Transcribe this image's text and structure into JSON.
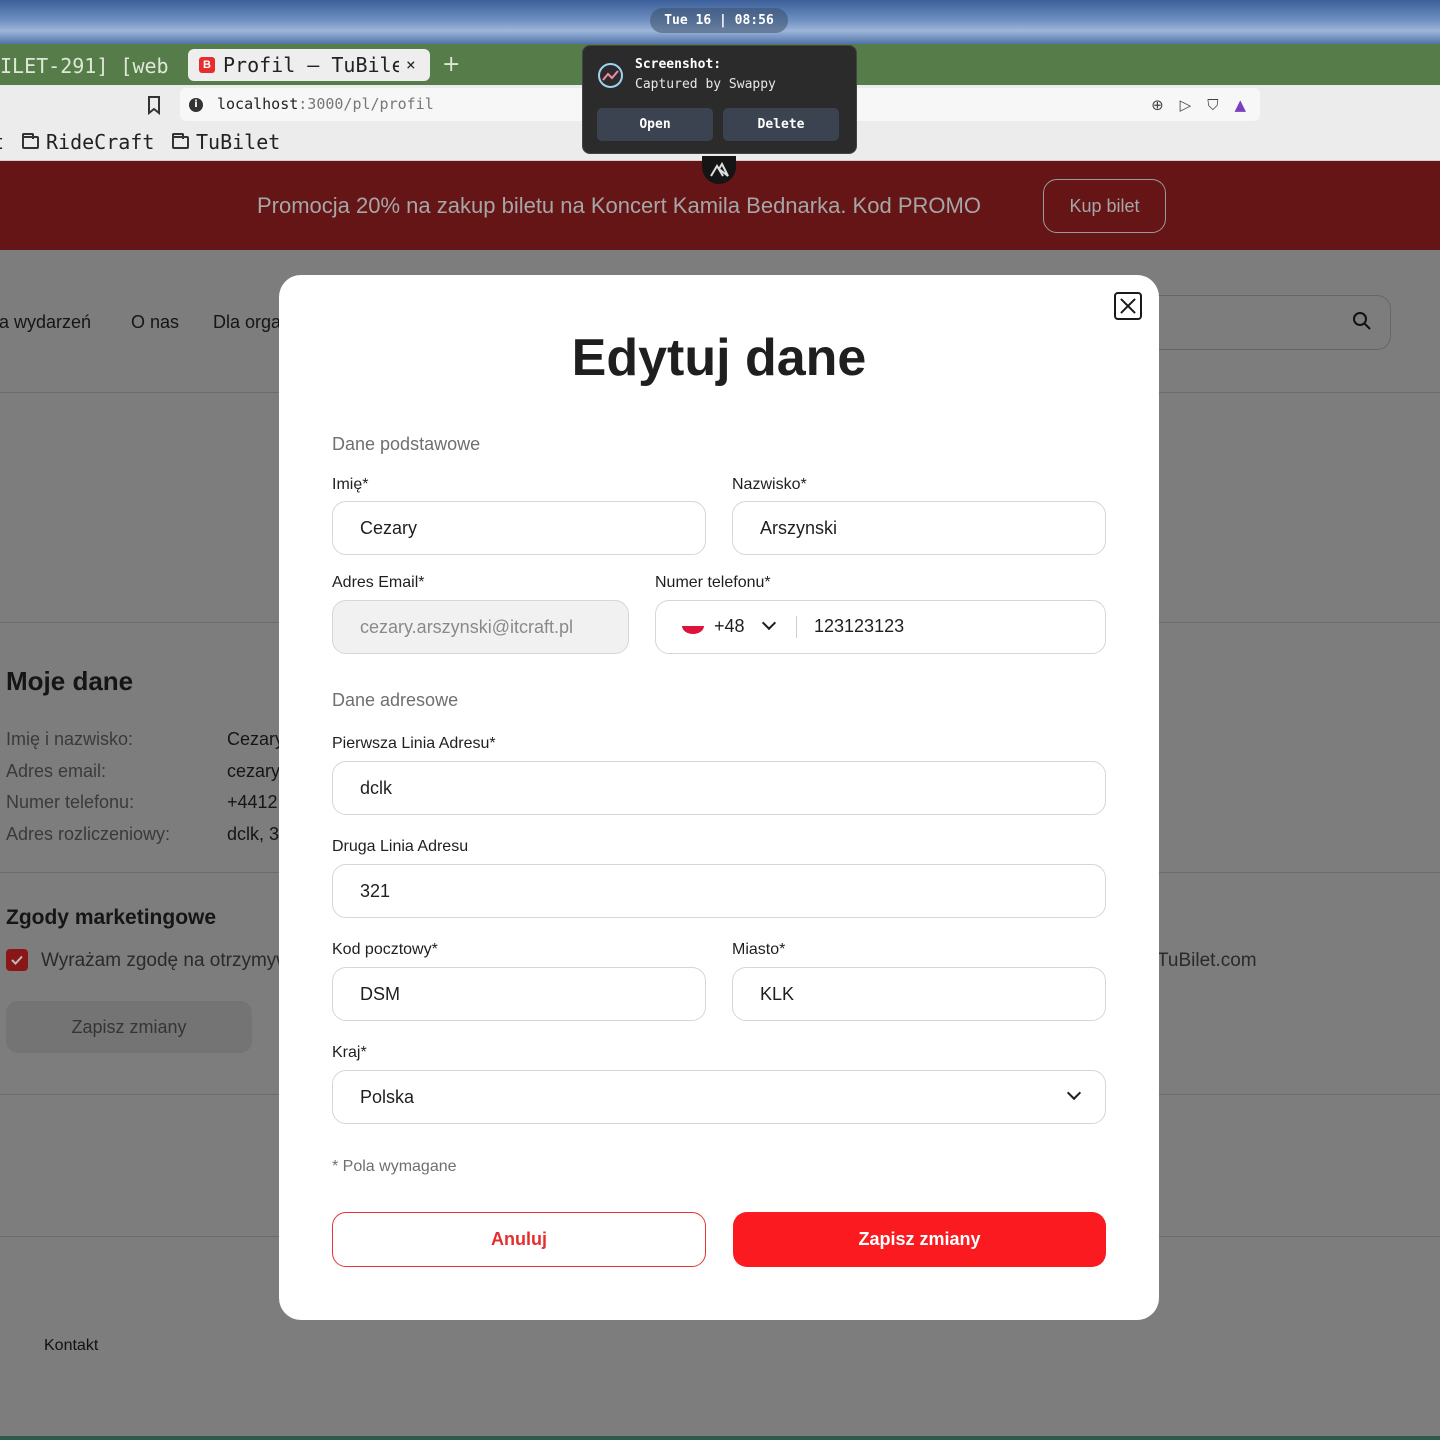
{
  "system": {
    "clock": "Tue 16 | 08:56"
  },
  "browser": {
    "tabs": [
      {
        "label": "ILET-291] [web"
      },
      {
        "label": "Profil – TuBilet",
        "favicon": "B",
        "close": "×"
      }
    ],
    "new_tab": "+",
    "url_host": "localhost",
    "url_rest": ":3000/pl/profil",
    "bookmarks": [
      {
        "label": "RideCraft"
      },
      {
        "label": "TuBilet"
      }
    ]
  },
  "toast": {
    "title": "Screenshot:",
    "subtitle": "Captured by Swappy",
    "open_label": "Open",
    "delete_label": "Delete"
  },
  "page": {
    "promo": {
      "text": "Promocja 20% na zakup biletu na Koncert Kamila Bednarka. Kod PROMO",
      "button": "Kup bilet"
    },
    "nav": [
      "ta wydarzeń",
      "O nas",
      "Dla orga"
    ],
    "my_data": {
      "title": "Moje dane",
      "rows": [
        {
          "label": "Imię i nazwisko:",
          "value": "Cezary"
        },
        {
          "label": "Adres email:",
          "value": "cezary"
        },
        {
          "label": "Numer telefonu:",
          "value": "+4412"
        },
        {
          "label": "Adres rozliczeniowy:",
          "value": "dclk, 3"
        }
      ]
    },
    "marketing": {
      "title": "Zgody marketingowe",
      "consent_text": "Wyrażam zgodę na otrzymyw",
      "consent_tail": "TuBilet.com",
      "save_label": "Zapisz zmiany"
    },
    "footer_link": "Kontakt"
  },
  "modal": {
    "title": "Edytuj dane",
    "section_basic": "Dane podstawowe",
    "section_address": "Dane adresowe",
    "first_name": {
      "label": "Imię*",
      "value": "Cezary"
    },
    "last_name": {
      "label": "Nazwisko*",
      "value": "Arszynski"
    },
    "email": {
      "label": "Adres Email*",
      "value": "cezary.arszynski@itcraft.pl"
    },
    "phone": {
      "label": "Numer telefonu*",
      "code": "+48",
      "value": "123123123"
    },
    "address1": {
      "label": "Pierwsza Linia Adresu*",
      "value": "dclk"
    },
    "address2": {
      "label": "Druga Linia Adresu",
      "value": "321"
    },
    "postal": {
      "label": "Kod pocztowy*",
      "value": "DSM"
    },
    "city": {
      "label": "Miasto*",
      "value": "KLK"
    },
    "country": {
      "label": "Kraj*",
      "value": "Polska"
    },
    "required_note": "* Pola wymagane",
    "cancel_label": "Anuluj",
    "save_label": "Zapisz zmiany"
  },
  "colors": {
    "accent": "#fa1a1f",
    "promo_bg": "#651516",
    "tab_bar": "#567d49"
  }
}
